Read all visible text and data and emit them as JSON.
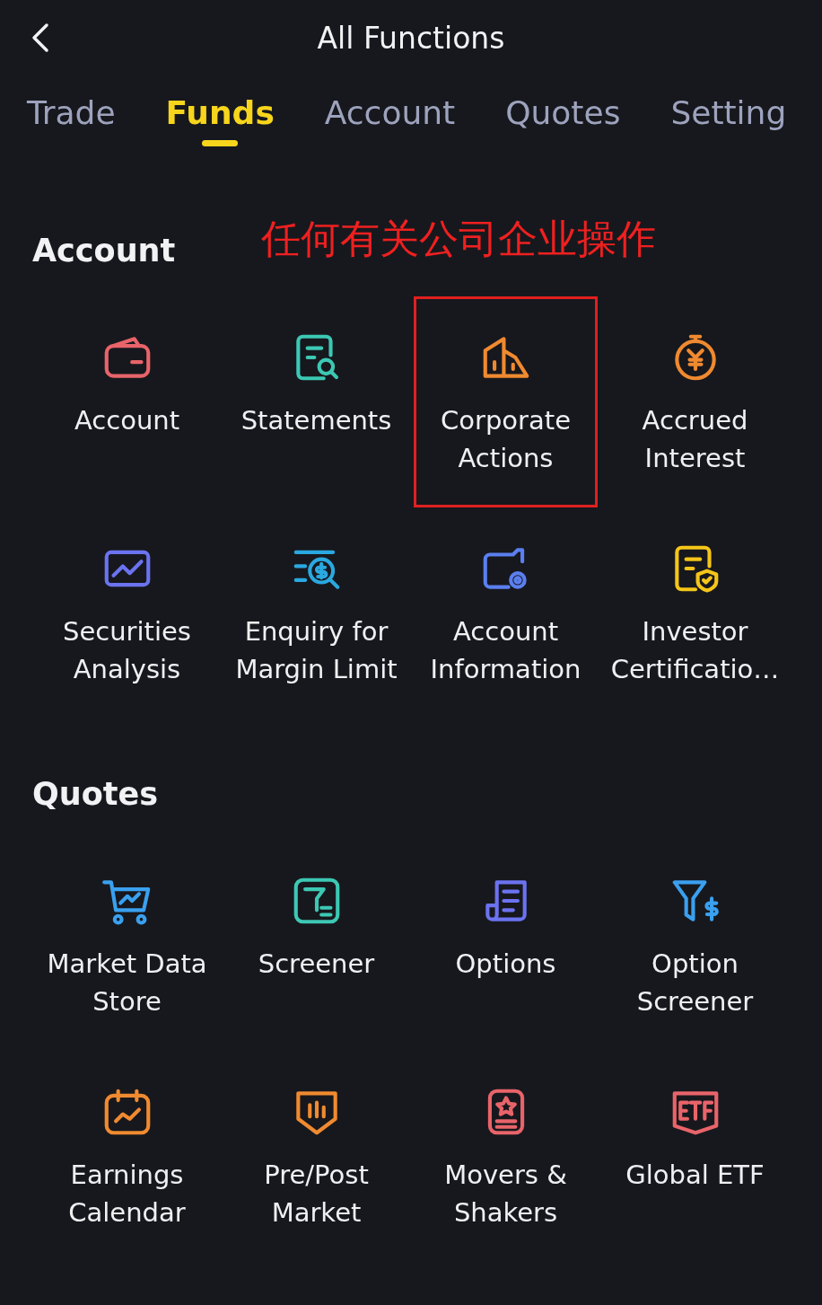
{
  "header": {
    "title": "All Functions"
  },
  "tabs": [
    {
      "label": "Trade",
      "selected": false
    },
    {
      "label": "Funds",
      "selected": true
    },
    {
      "label": "Account",
      "selected": false
    },
    {
      "label": "Quotes",
      "selected": false
    },
    {
      "label": "Setting",
      "selected": false
    }
  ],
  "sections": [
    {
      "title": "Account",
      "annotation": "任何有关公司企业操作",
      "items": [
        {
          "label": "Account",
          "kind": "wallet",
          "color": "#e8646a",
          "highlighted": false
        },
        {
          "label": "Statements",
          "kind": "statement",
          "color": "#3cc8b4",
          "highlighted": false
        },
        {
          "label": "Corporate\nActions",
          "kind": "building",
          "color": "#f08a30",
          "highlighted": true
        },
        {
          "label": "Accrued\nInterest",
          "kind": "yen",
          "color": "#f08a30",
          "highlighted": false
        },
        {
          "label": "Securities\nAnalysis",
          "kind": "chart",
          "color": "#6b73f0",
          "highlighted": false
        },
        {
          "label": "Enquiry for\nMargin Limit",
          "kind": "dollar-search",
          "color": "#2aa8e0",
          "highlighted": false
        },
        {
          "label": "Account\nInformation",
          "kind": "folder-gear",
          "color": "#5b7ff0",
          "highlighted": false
        },
        {
          "label": "Investor\nCertificatio…",
          "kind": "doc-shield",
          "color": "#f5c518",
          "highlighted": false
        }
      ]
    },
    {
      "title": "Quotes",
      "items": [
        {
          "label": "Market Data\nStore",
          "kind": "cart",
          "color": "#3aa0f0",
          "highlighted": false
        },
        {
          "label": "Screener",
          "kind": "filter-doc",
          "color": "#3cc8b4",
          "highlighted": false
        },
        {
          "label": "Options",
          "kind": "list-doc",
          "color": "#6b73f0",
          "highlighted": false
        },
        {
          "label": "Option\nScreener",
          "kind": "filter-dollar",
          "color": "#3aa0f0",
          "highlighted": false
        },
        {
          "label": "Earnings\nCalendar",
          "kind": "calendar",
          "color": "#f08a30",
          "highlighted": false
        },
        {
          "label": "Pre/Post\nMarket",
          "kind": "bars-shield",
          "color": "#f08a30",
          "highlighted": false
        },
        {
          "label": "Movers &\nShakers",
          "kind": "badge-doc",
          "color": "#e8646a",
          "highlighted": false
        },
        {
          "label": "Global ETF",
          "kind": "etf",
          "color": "#e8646a",
          "highlighted": false
        }
      ]
    }
  ]
}
